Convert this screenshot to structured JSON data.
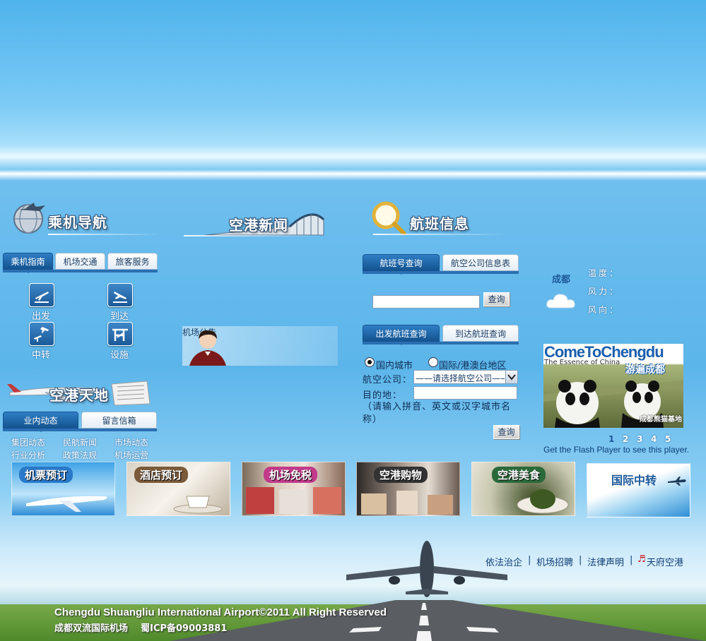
{
  "nav_section": {
    "title": "乘机导航",
    "tabs": [
      "乘机指南",
      "机场交通",
      "旅客服务"
    ],
    "items": [
      "出发",
      "到达",
      "中转",
      "设施"
    ]
  },
  "news_section": {
    "title": "空港新闻"
  },
  "notice_section": {
    "title": "机场公告"
  },
  "world_section": {
    "title": "空港天地",
    "tabs": [
      "业内动态",
      "留言信箱"
    ],
    "links": [
      "集团动态",
      "民航新闻",
      "市场动态",
      "行业分析",
      "政策法规",
      "机场运营"
    ]
  },
  "flight_section": {
    "title": "航班信息",
    "tabs_top": [
      "航班号查询",
      "航空公司信息表"
    ],
    "search_button": "查询",
    "tabs_mid": [
      "出发航班查询",
      "到达航班查询"
    ],
    "radio_domestic": "国内城市",
    "radio_intl": "国际/港澳台地区",
    "airline_label": "航空公司：",
    "airline_select": "——请选择航空公司——",
    "dest_label": "目的地：",
    "hint": "（请输入拼音、英文或汉字城市名称）",
    "query_button": "查询"
  },
  "weather": {
    "city": "成都",
    "temp_label": "温度：",
    "wind_label": "风力：",
    "dir_label": "风向："
  },
  "promo": {
    "title": "ComeToChengdu",
    "subtitle": "The Essence of China",
    "cn_title": "游遍成都",
    "caption": "成都熊猫基地",
    "pages": [
      "1",
      "2",
      "3",
      "4",
      "5"
    ],
    "flash_link": "Get the Flash Player",
    "flash_tail": " to see this player."
  },
  "banners": [
    "机票预订",
    "酒店预订",
    "机场免税",
    "空港购物",
    "空港美食",
    "国际中转"
  ],
  "footer": {
    "links": [
      "依法治企",
      "机场招聘",
      "法律声明",
      "天府空港"
    ],
    "separator": "|",
    "copyright": "Chengdu Shuangliu International Airport©2011 All Right Reserved",
    "icp": "成都双流国际机场    蜀ICP备09003881"
  }
}
